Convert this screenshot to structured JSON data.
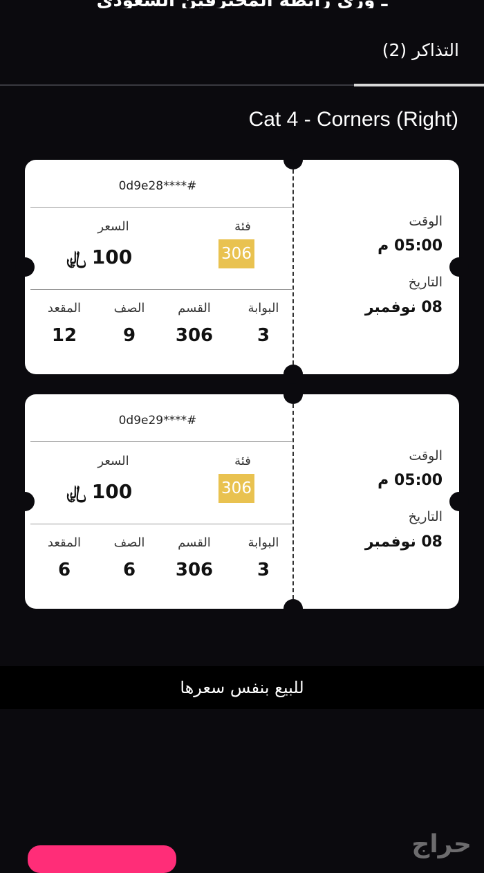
{
  "header": {
    "cut_title": "ـ وري رابطة المحترفين السعودي"
  },
  "tabs": {
    "active_label": "التذاكر (2)"
  },
  "category_title": "Cat 4 - Corners (Right)",
  "labels": {
    "time": "الوقت",
    "date": "التاريخ",
    "category": "فئة",
    "price": "السعر",
    "gate": "البوابة",
    "section": "القسم",
    "row": "الصف",
    "seat": "المقعد"
  },
  "tickets": [
    {
      "id": "0d9e28****#",
      "time": "05:00 م",
      "date": "08 نوفمبر",
      "category": "306",
      "price": "100",
      "currency_symbol": "﷼",
      "gate": "3",
      "section": "306",
      "row": "9",
      "seat": "12"
    },
    {
      "id": "0d9e29****#",
      "time": "05:00 م",
      "date": "08 نوفمبر",
      "category": "306",
      "price": "100",
      "currency_symbol": "﷼",
      "gate": "3",
      "section": "306",
      "row": "6",
      "seat": "6"
    }
  ],
  "sale_note": "للبيع بنفس سعرها",
  "watermark": "حراج",
  "colors": {
    "background": "#0b0a0e",
    "category_badge": "#e9c250",
    "action_button": "#ff2d78"
  }
}
